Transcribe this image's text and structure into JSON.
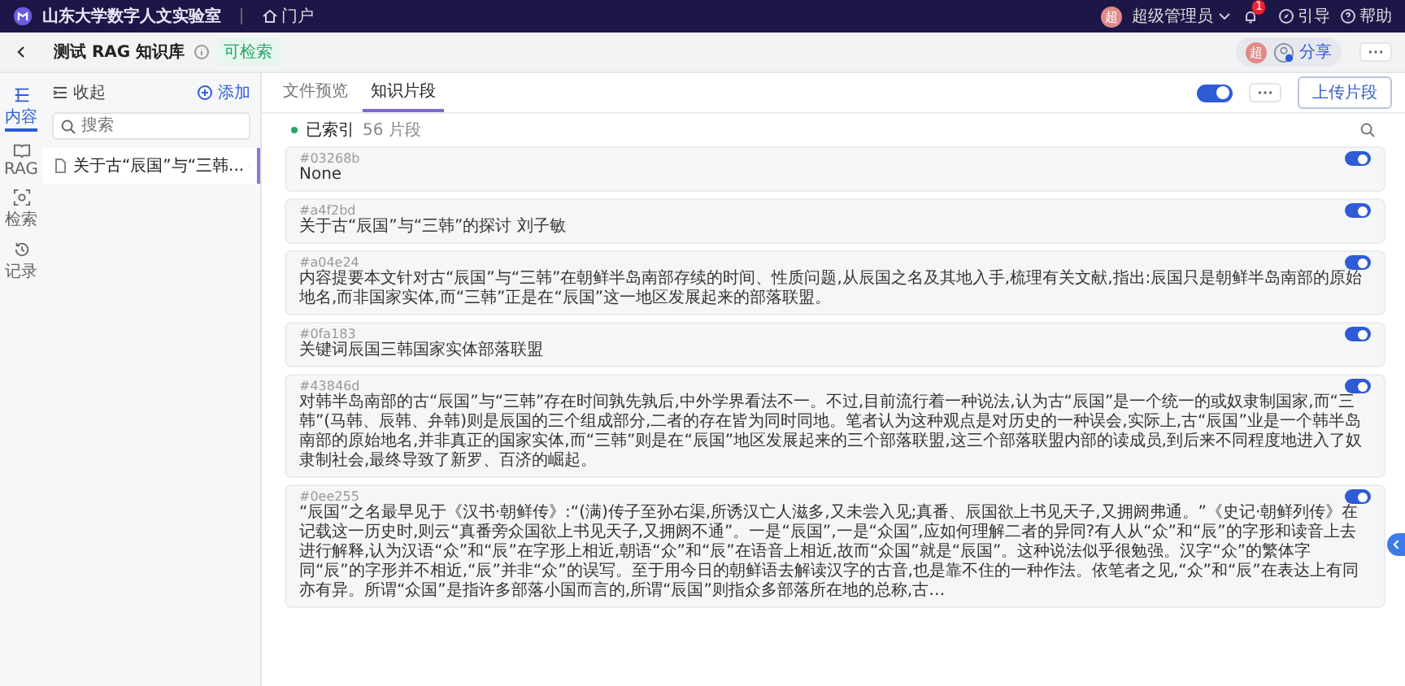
{
  "topbar": {
    "org": "山东大学数字人文实验室",
    "portal": "门户",
    "user_initial": "超",
    "user": "超级管理员",
    "notifications": "1",
    "guide": "引导",
    "help": "帮助"
  },
  "header": {
    "title": "测试 RAG 知识库",
    "tag": "可检索",
    "owner_initial": "超",
    "share": "分享"
  },
  "rail": [
    {
      "label": "内容",
      "selected": true,
      "kind": "content"
    },
    {
      "label": "RAG",
      "selected": false,
      "kind": "rag"
    },
    {
      "label": "检索",
      "selected": false,
      "kind": "search"
    },
    {
      "label": "记录",
      "selected": false,
      "kind": "history"
    }
  ],
  "sidebar": {
    "collapse": "收起",
    "add": "添加",
    "search_placeholder": "搜索",
    "files": [
      {
        "name": "关于古“辰国”与“三韩...",
        "selected": true
      }
    ]
  },
  "tabs": [
    {
      "label": "文件预览",
      "selected": false
    },
    {
      "label": "知识片段",
      "selected": true
    }
  ],
  "toolbar": {
    "enabled": {
      "on": true
    },
    "upload": "上传片段"
  },
  "status": {
    "label": "已索引",
    "count": "56 片段"
  },
  "chunks": [
    {
      "id": "#03268b",
      "text": "None",
      "on": true
    },
    {
      "id": "#a4f2bd",
      "text": "关于古“辰国”与“三韩”的探讨 刘子敏",
      "on": true
    },
    {
      "id": "#a04e24",
      "text": "内容提要本文针对古“辰国”与“三韩”在朝鲜半岛南部存续的时间、性质问题,从辰国之名及其地入手,梳理有关文献,指出:辰国只是朝鲜半岛南部的原始地名,而非国家实体,而“三韩”正是在“辰国”这一地区发展起来的部落联盟。",
      "on": true
    },
    {
      "id": "#0fa183",
      "text": "关键词辰国三韩国家实体部落联盟",
      "on": true
    },
    {
      "id": "#43846d",
      "text": "对韩半岛南部的古“辰国”与“三韩”存在时间孰先孰后,中外学界看法不一。不过,目前流行着一种说法,认为古“辰国”是一个统一的或奴隶制国家,而“三韩”(马韩、辰韩、弁韩)则是辰国的三个组成部分,二者的存在皆为同时同地。笔者认为这种观点是对历史的一种误会,实际上,古“辰国”业是一个韩半岛南部的原始地名,并非真正的国家实体,而“三韩”则是在“辰国”地区发展起来的三个部落联盟,这三个部落联盟内部的读成员,到后来不同程度地进入了奴隶制社会,最终导致了新罗、百济的崛起。",
      "on": true
    },
    {
      "id": "#0ee255",
      "text": "“辰国”之名最早见于《汉书·朝鲜传》:“(满)传子至孙右渠,所诱汉亡人滋多,又未尝入见;真番、辰国欲上书见天子,又拥阏弗通。”《史记·朝鲜列传》在记载这一历史时,则云“真番旁众国欲上书见天子,又拥阏不通”。一是“辰国”,一是“众国”,应如何理解二者的异同?有人从“众”和“辰”的字形和读音上去进行解释,认为汉语“众”和“辰”在字形上相近,朝语“众”和“辰”在语音上相近,故而“众国”就是“辰国”。这种说法似乎很勉强。汉字“众”的繁体字同“辰”的字形并不相近,“辰”并非“众”的误写。至于用今日的朝鲜语去解读汉字的古音,也是靠不住的一种作法。依笔者之见,“众”和“辰”在表达上有同亦有异。所谓“众国”是指许多部落小国而言的,所谓“辰国”则指众多部落所在地的总称,古…",
      "on": true
    }
  ]
}
